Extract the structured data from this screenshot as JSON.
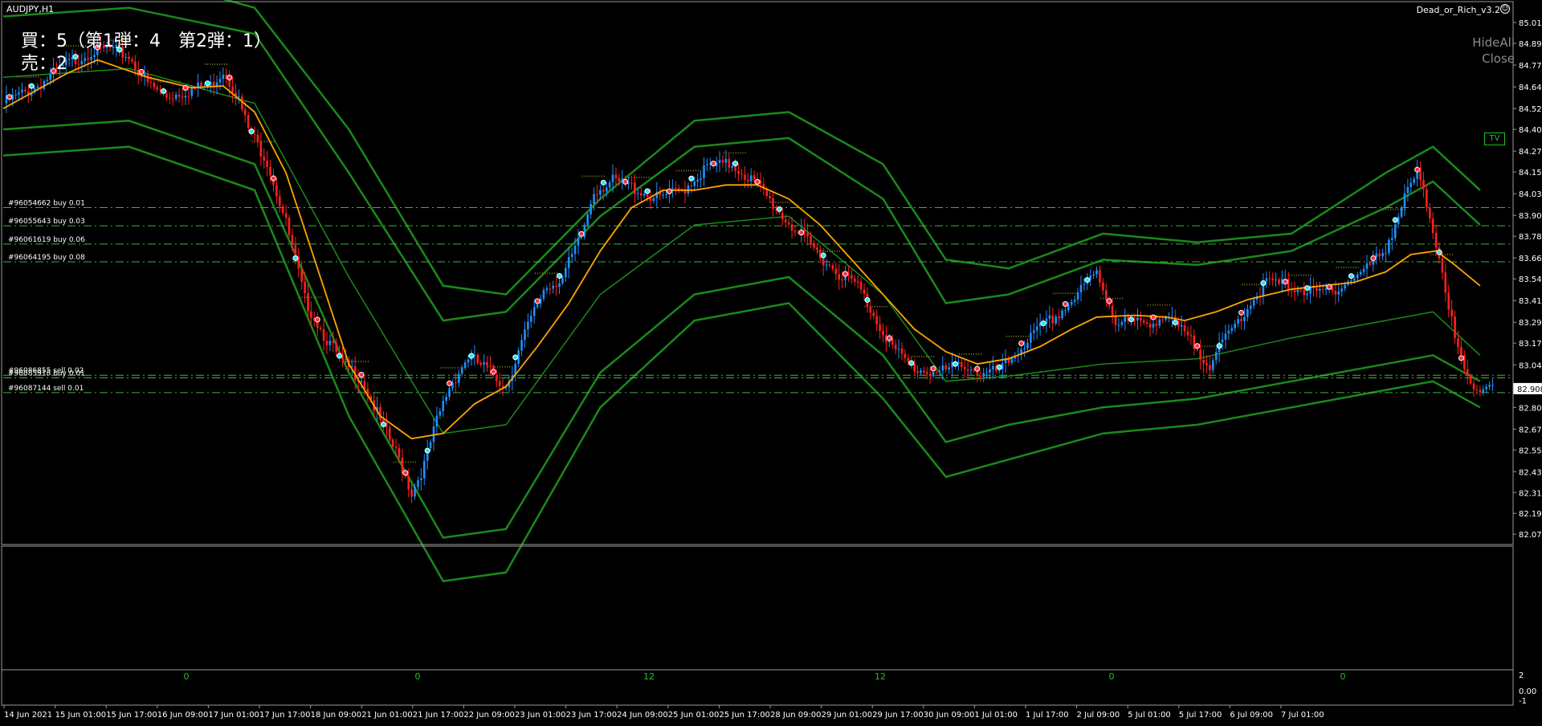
{
  "window": {
    "symbol": "AUDJPY,H1",
    "ea_name": "Dead_or_Rich_v3.2",
    "hide_all": "HideAll",
    "close": "Close",
    "tv": "TV"
  },
  "hud": {
    "line1": "買：5（第1弾：4　第2弾：1）",
    "line2": "売：2"
  },
  "colors": {
    "background": "#000000",
    "bull_candle": "#1e90ff",
    "bear_candle": "#ff2020",
    "ma": "#ffa500",
    "bands": "#1a8a1a",
    "order_lines": "#3cb43c",
    "grid_text": "#ffffff"
  },
  "chart_data": {
    "type": "candlestick",
    "instrument": "AUDJPY",
    "timeframe": "H1",
    "ylim": [
      82.02,
      85.08
    ],
    "y_ticks": [
      85.015,
      84.895,
      84.77,
      84.645,
      84.52,
      84.4,
      84.275,
      84.155,
      84.03,
      83.905,
      83.785,
      83.66,
      83.54,
      83.415,
      83.29,
      83.17,
      83.045,
      82.92,
      82.8,
      82.675,
      82.555,
      82.43,
      82.31,
      82.19,
      82.07
    ],
    "x_tick_labels": [
      "14 Jun 2021",
      "15 Jun 01:00",
      "15 Jun 17:00",
      "16 Jun 09:00",
      "17 Jun 01:00",
      "17 Jun 17:00",
      "18 Jun 09:00",
      "21 Jun 01:00",
      "21 Jun 17:00",
      "22 Jun 09:00",
      "23 Jun 01:00",
      "23 Jun 17:00",
      "24 Jun 09:00",
      "25 Jun 01:00",
      "25 Jun 17:00",
      "28 Jun 09:00",
      "29 Jun 01:00",
      "29 Jun 17:00",
      "30 Jun 09:00",
      "1 Jul 01:00",
      "1 Jul 17:00",
      "2 Jul 09:00",
      "5 Jul 01:00",
      "5 Jul 17:00",
      "6 Jul 09:00",
      "7 Jul 01:00"
    ],
    "current_price": "82.908",
    "price_path": [
      [
        0,
        84.55
      ],
      [
        10,
        84.64
      ],
      [
        20,
        84.77
      ],
      [
        28,
        84.85
      ],
      [
        34,
        84.86
      ],
      [
        40,
        84.82
      ],
      [
        46,
        84.66
      ],
      [
        52,
        84.59
      ],
      [
        60,
        84.63
      ],
      [
        66,
        84.65
      ],
      [
        70,
        84.74
      ],
      [
        74,
        84.62
      ],
      [
        78,
        84.4
      ],
      [
        84,
        84.22
      ],
      [
        90,
        83.86
      ],
      [
        96,
        83.42
      ],
      [
        102,
        83.22
      ],
      [
        108,
        83.05
      ],
      [
        114,
        82.97
      ],
      [
        120,
        82.72
      ],
      [
        126,
        82.5
      ],
      [
        130,
        82.31
      ],
      [
        134,
        82.47
      ],
      [
        138,
        82.72
      ],
      [
        142,
        82.92
      ],
      [
        148,
        83.09
      ],
      [
        154,
        83.02
      ],
      [
        160,
        82.92
      ],
      [
        166,
        83.22
      ],
      [
        172,
        83.48
      ],
      [
        178,
        83.55
      ],
      [
        184,
        83.78
      ],
      [
        188,
        84.05
      ],
      [
        194,
        84.1
      ],
      [
        200,
        84.07
      ],
      [
        208,
        84.0
      ],
      [
        216,
        84.05
      ],
      [
        224,
        84.18
      ],
      [
        232,
        84.2
      ],
      [
        240,
        84.08
      ],
      [
        248,
        83.9
      ],
      [
        256,
        83.75
      ],
      [
        264,
        83.6
      ],
      [
        272,
        83.5
      ],
      [
        278,
        83.3
      ],
      [
        284,
        83.12
      ],
      [
        290,
        83.02
      ],
      [
        298,
        83.0
      ],
      [
        306,
        83.05
      ],
      [
        312,
        82.98
      ],
      [
        318,
        83.02
      ],
      [
        324,
        83.15
      ],
      [
        330,
        83.25
      ],
      [
        336,
        83.34
      ],
      [
        342,
        83.45
      ],
      [
        348,
        83.58
      ],
      [
        354,
        83.3
      ],
      [
        362,
        83.28
      ],
      [
        370,
        83.32
      ],
      [
        376,
        83.22
      ],
      [
        384,
        83.05
      ],
      [
        390,
        83.22
      ],
      [
        396,
        83.38
      ],
      [
        402,
        83.52
      ],
      [
        410,
        83.5
      ],
      [
        418,
        83.45
      ],
      [
        426,
        83.5
      ],
      [
        434,
        83.6
      ],
      [
        440,
        83.72
      ],
      [
        446,
        84.0
      ],
      [
        450,
        84.15
      ],
      [
        454,
        83.9
      ],
      [
        458,
        83.6
      ],
      [
        462,
        83.18
      ],
      [
        466,
        82.95
      ],
      [
        470,
        82.9
      ],
      [
        474,
        82.95
      ]
    ],
    "ma_series": {
      "name": "",
      "values": [
        [
          0,
          84.52
        ],
        [
          20,
          84.72
        ],
        [
          30,
          84.8
        ],
        [
          46,
          84.7
        ],
        [
          60,
          84.64
        ],
        [
          70,
          84.65
        ],
        [
          80,
          84.5
        ],
        [
          90,
          84.15
        ],
        [
          100,
          83.6
        ],
        [
          110,
          83.05
        ],
        [
          120,
          82.75
        ],
        [
          130,
          82.62
        ],
        [
          140,
          82.65
        ],
        [
          150,
          82.82
        ],
        [
          160,
          82.92
        ],
        [
          170,
          83.15
        ],
        [
          180,
          83.4
        ],
        [
          190,
          83.7
        ],
        [
          200,
          83.95
        ],
        [
          210,
          84.05
        ],
        [
          220,
          84.05
        ],
        [
          230,
          84.08
        ],
        [
          240,
          84.08
        ],
        [
          250,
          84.0
        ],
        [
          260,
          83.85
        ],
        [
          270,
          83.65
        ],
        [
          280,
          83.45
        ],
        [
          290,
          83.25
        ],
        [
          300,
          83.12
        ],
        [
          310,
          83.05
        ],
        [
          320,
          83.08
        ],
        [
          330,
          83.15
        ],
        [
          340,
          83.25
        ],
        [
          348,
          83.32
        ],
        [
          360,
          83.33
        ],
        [
          370,
          83.32
        ],
        [
          376,
          83.3
        ],
        [
          386,
          83.35
        ],
        [
          396,
          83.42
        ],
        [
          410,
          83.48
        ],
        [
          420,
          83.5
        ],
        [
          430,
          83.52
        ],
        [
          440,
          83.58
        ],
        [
          448,
          83.68
        ],
        [
          456,
          83.7
        ],
        [
          462,
          83.62
        ],
        [
          470,
          83.5
        ]
      ]
    },
    "band_series": [
      {
        "name": "",
        "values": [
          [
            0,
            85.2
          ],
          [
            40,
            85.3
          ],
          [
            80,
            85.1
          ],
          [
            110,
            84.4
          ],
          [
            140,
            83.5
          ],
          [
            160,
            83.45
          ],
          [
            190,
            84.0
          ],
          [
            220,
            84.45
          ],
          [
            250,
            84.5
          ],
          [
            280,
            84.2
          ],
          [
            300,
            83.65
          ],
          [
            320,
            83.6
          ],
          [
            350,
            83.8
          ],
          [
            380,
            83.75
          ],
          [
            410,
            83.8
          ],
          [
            440,
            84.15
          ],
          [
            455,
            84.3
          ],
          [
            470,
            84.05
          ]
        ]
      },
      {
        "name": "",
        "values": [
          [
            0,
            85.05
          ],
          [
            40,
            85.1
          ],
          [
            80,
            84.95
          ],
          [
            110,
            84.15
          ],
          [
            140,
            83.3
          ],
          [
            160,
            83.35
          ],
          [
            190,
            83.9
          ],
          [
            220,
            84.3
          ],
          [
            250,
            84.35
          ],
          [
            280,
            84.0
          ],
          [
            300,
            83.4
          ],
          [
            320,
            83.45
          ],
          [
            350,
            83.65
          ],
          [
            380,
            83.62
          ],
          [
            410,
            83.7
          ],
          [
            440,
            83.95
          ],
          [
            455,
            84.1
          ],
          [
            470,
            83.85
          ]
        ]
      },
      {
        "name": "",
        "values": [
          [
            0,
            84.7
          ],
          [
            40,
            84.75
          ],
          [
            80,
            84.55
          ],
          [
            110,
            83.55
          ],
          [
            140,
            82.65
          ],
          [
            160,
            82.7
          ],
          [
            190,
            83.45
          ],
          [
            220,
            83.85
          ],
          [
            250,
            83.9
          ],
          [
            280,
            83.45
          ],
          [
            300,
            82.95
          ],
          [
            320,
            82.98
          ],
          [
            350,
            83.05
          ],
          [
            380,
            83.08
          ],
          [
            410,
            83.2
          ],
          [
            440,
            83.3
          ],
          [
            455,
            83.35
          ],
          [
            470,
            83.1
          ]
        ]
      },
      {
        "name": "",
        "values": [
          [
            0,
            84.4
          ],
          [
            40,
            84.45
          ],
          [
            80,
            84.2
          ],
          [
            110,
            83.0
          ],
          [
            140,
            82.05
          ],
          [
            160,
            82.1
          ],
          [
            190,
            83.0
          ],
          [
            220,
            83.45
          ],
          [
            250,
            83.55
          ],
          [
            280,
            83.1
          ],
          [
            300,
            82.6
          ],
          [
            320,
            82.7
          ],
          [
            350,
            82.8
          ],
          [
            380,
            82.85
          ],
          [
            410,
            82.95
          ],
          [
            440,
            83.05
          ],
          [
            455,
            83.1
          ],
          [
            470,
            82.95
          ]
        ]
      },
      {
        "name": "",
        "values": [
          [
            0,
            84.25
          ],
          [
            40,
            84.3
          ],
          [
            80,
            84.05
          ],
          [
            110,
            82.75
          ],
          [
            140,
            81.8
          ],
          [
            160,
            81.85
          ],
          [
            190,
            82.8
          ],
          [
            220,
            83.3
          ],
          [
            250,
            83.4
          ],
          [
            280,
            82.85
          ],
          [
            300,
            82.4
          ],
          [
            320,
            82.5
          ],
          [
            350,
            82.65
          ],
          [
            380,
            82.7
          ],
          [
            410,
            82.8
          ],
          [
            440,
            82.9
          ],
          [
            455,
            82.95
          ],
          [
            470,
            82.8
          ]
        ]
      }
    ],
    "order_lines": [
      {
        "label": "#96054662 buy 0.01",
        "price": 83.95
      },
      {
        "label": "#96055643 buy 0.03",
        "price": 83.845
      },
      {
        "label": "#96061619 buy 0.06",
        "price": 83.74
      },
      {
        "label": "#96064195 buy 0.08",
        "price": 83.638
      },
      {
        "label": "#96086855 sell 0.02",
        "price": 82.985
      },
      {
        "label": "#96085918 buy 0.01",
        "price": 82.97
      },
      {
        "label": "#96087144 sell 0.01",
        "price": 82.885
      }
    ],
    "subwindow": {
      "y_ticks": [
        "2",
        "0.00",
        "-1"
      ],
      "markers": [
        "0",
        "0",
        "12",
        "12",
        "0",
        "0"
      ]
    }
  }
}
